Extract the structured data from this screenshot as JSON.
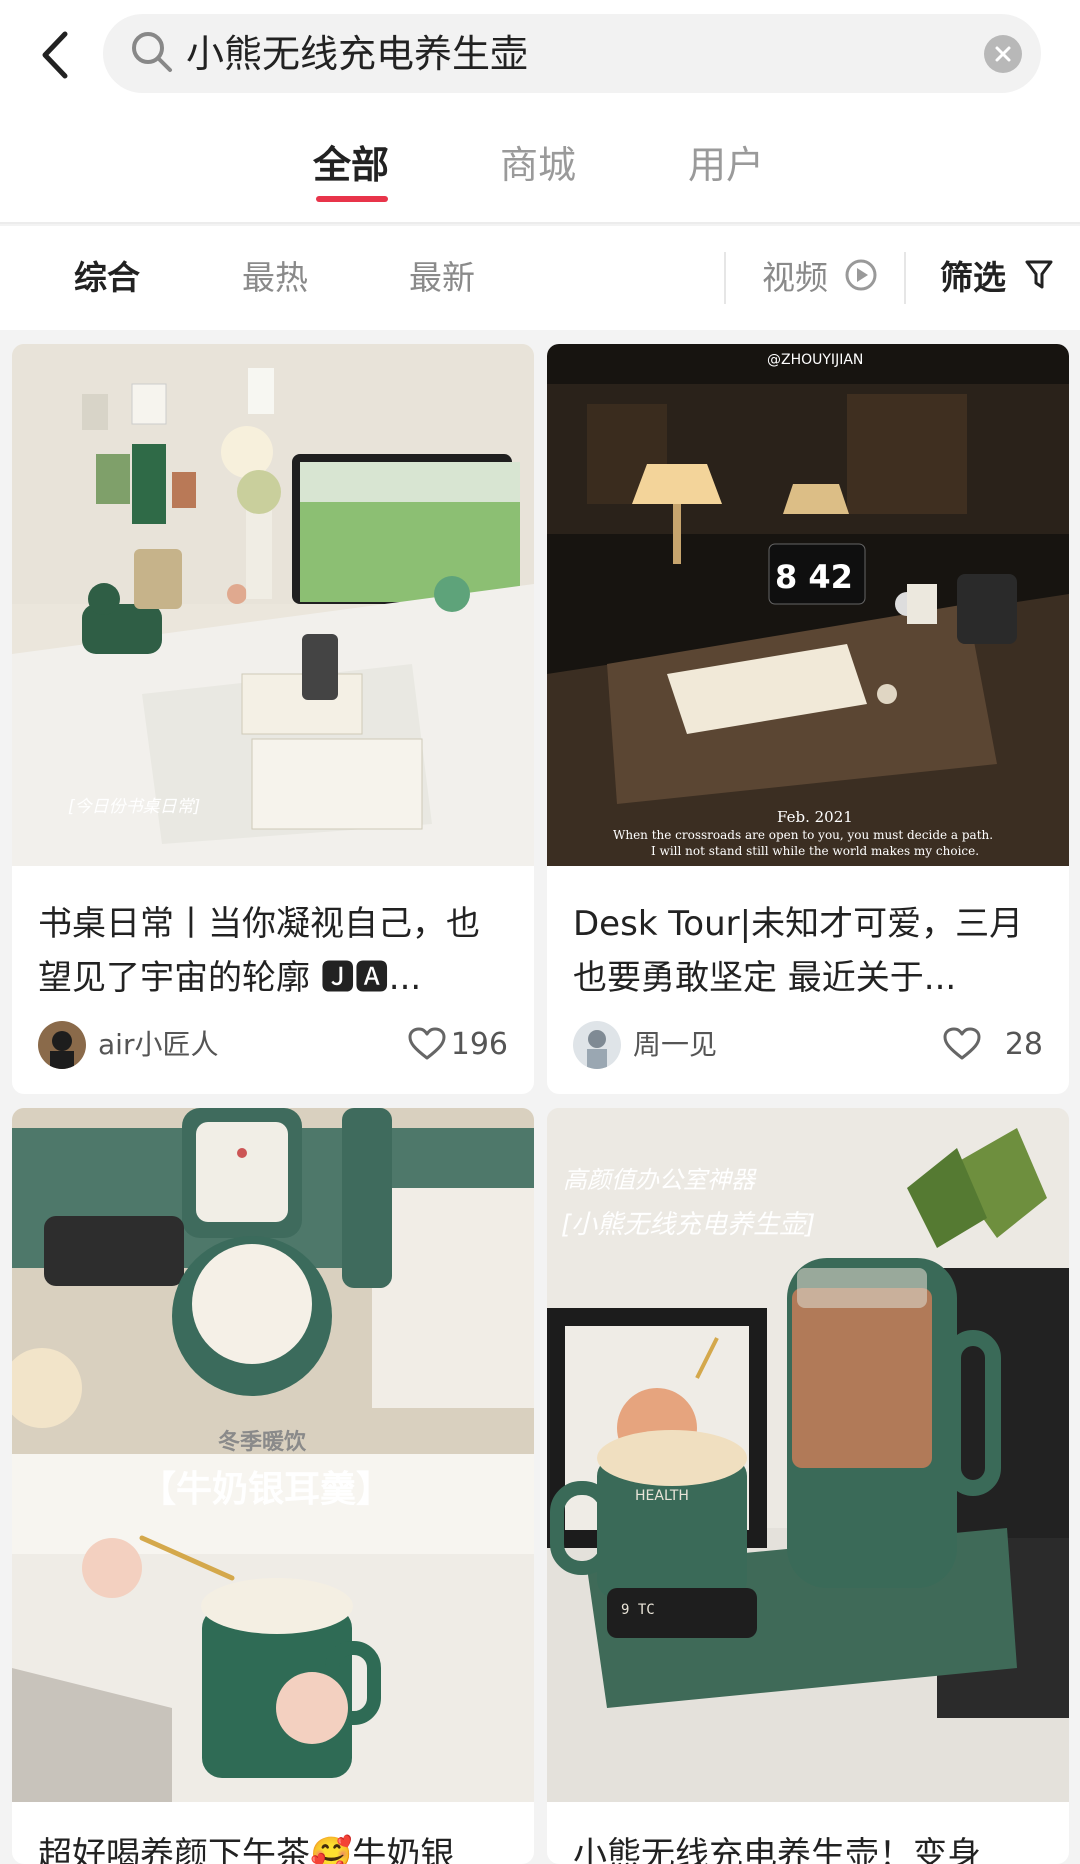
{
  "search": {
    "query": "小熊无线充电养生壶"
  },
  "main_tabs": [
    {
      "label": "全部",
      "active": true
    },
    {
      "label": "商城",
      "active": false
    },
    {
      "label": "用户",
      "active": false
    }
  ],
  "sort": {
    "items": [
      "综合",
      "最热",
      "最新"
    ],
    "video_label": "视频",
    "filter_label": "筛选"
  },
  "colors": {
    "accent": "#e8344a",
    "card_bg": "#ffffff",
    "page_bg": "#f3f3f3"
  },
  "cards": [
    {
      "title": "书桌日常丨当你凝视自己，也望见了宇宙的轮廓 🅹🅰...",
      "overlay": "[今日份书桌日常]",
      "author": "air小匠人",
      "likes": "196"
    },
    {
      "title": "Desk Tour|未知才可爱，三月也要勇敢坚定 最近关于...",
      "overlay_top": "@ZHOUYIJIAN",
      "overlay_clock": "8 42",
      "overlay_date": "Feb. 2021",
      "overlay_quote_1": "When the crossroads are open to you, you must decide a path.",
      "overlay_quote_2": "I will not stand still while the world makes my choice.",
      "author": "周一见",
      "likes": "28"
    },
    {
      "title": "超好喝养颜下午茶🥰牛奶银",
      "overlay_1": "冬季暖饮",
      "overlay_2": "【牛奶银耳羹】"
    },
    {
      "title": "小熊无线充电养生壶！变身",
      "overlay_1": "高颜值办公室神器",
      "overlay_2": "[小熊无线充电养生壶]",
      "mug_text": "HEALTH",
      "display_text": "9 TC"
    }
  ]
}
